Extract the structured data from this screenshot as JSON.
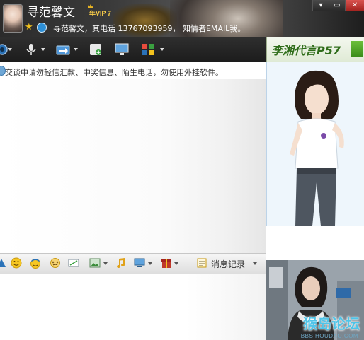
{
  "window": {
    "controls": [
      "▾",
      "▭",
      "✕"
    ]
  },
  "contact": {
    "name": "寻范馨文",
    "vip_badge": "年VIP 7",
    "status_line": "寻范馨文，其电话 13767093959， 知情者EMAIL我。"
  },
  "toolbar": {
    "icons": [
      "video-call-icon",
      "voice-call-icon",
      "file-transfer-icon",
      "add-member-icon",
      "remote-desktop-icon",
      "apps-icon"
    ]
  },
  "notice": {
    "text": "交谈中请勿轻信汇款、中奖信息、陌生电话，勿使用外挂软件。"
  },
  "ad": {
    "banner_text": "李湘代言P57"
  },
  "input_toolbar": {
    "icons": [
      "font-icon",
      "emoticon-icon",
      "magic-emoticon-icon",
      "shake-icon",
      "screenshot-icon",
      "image-icon",
      "music-icon",
      "screen-share-icon",
      "gift-icon",
      "history-icon"
    ],
    "history_label": "消息记录"
  },
  "watermark": {
    "main": "猴岛论坛",
    "sub": "BBS.HOUDAO.COM"
  },
  "colors": {
    "header_bg": "#2b2b2b",
    "toolbar_bg": "#1c1c1c",
    "ad_green": "#2f6d1a",
    "watermark": "#4fc4e8",
    "vip_gold": "#ffd24a"
  }
}
